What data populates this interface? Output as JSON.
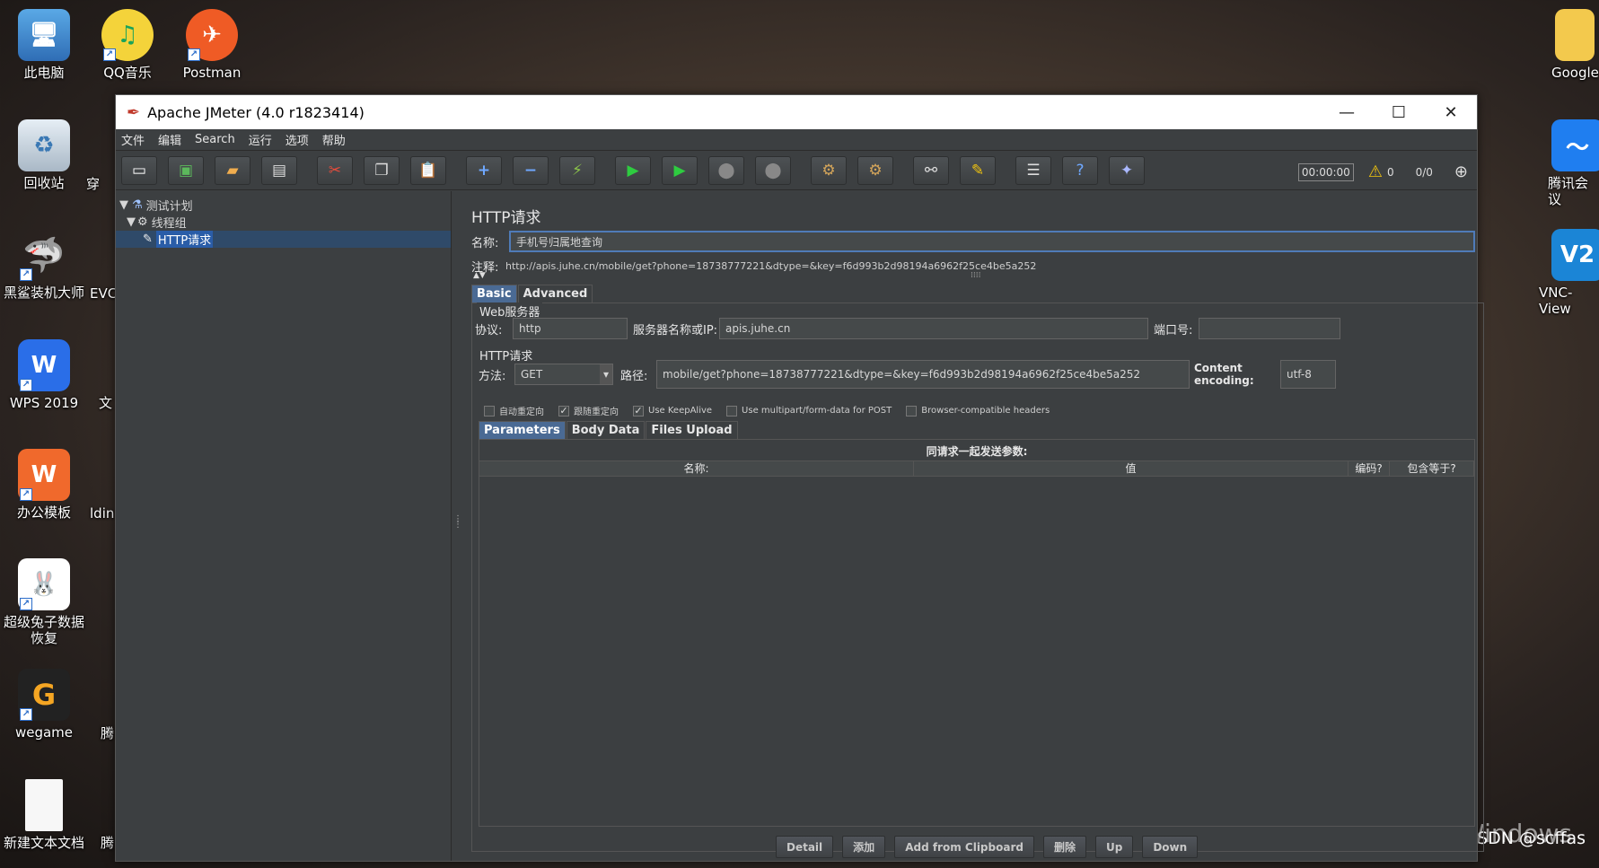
{
  "desktop": {
    "icons": [
      {
        "label": "此电脑",
        "icon": "computer-icon"
      },
      {
        "label": "QQ音乐",
        "icon": "qq-music-icon"
      },
      {
        "label": "Postman",
        "icon": "postman-icon"
      },
      {
        "label": "回收站",
        "icon": "recycle-bin-icon"
      },
      {
        "label": "黑鲨装机大师",
        "icon": "black-shark-icon"
      },
      {
        "label": "WPS 2019",
        "icon": "wps-icon"
      },
      {
        "label": "办公模板",
        "icon": "office-template-icon"
      },
      {
        "label": "超级兔子数据恢复",
        "icon": "rabbit-icon"
      },
      {
        "label": "wegame",
        "icon": "wegame-icon"
      },
      {
        "label": "新建文本文档",
        "icon": "text-file-icon"
      },
      {
        "label": "Google",
        "icon": "folder-icon"
      },
      {
        "label": "腾讯会议",
        "icon": "tencent-meeting-icon"
      },
      {
        "label": "VNC-View",
        "icon": "vnc-icon"
      },
      {
        "label": "EVC",
        "icon": "evc-icon"
      },
      {
        "label": "文",
        "icon": "doc-icon"
      },
      {
        "label": "ldin",
        "icon": "ldin-icon"
      },
      {
        "label": "腾",
        "icon": "tencent-icon"
      },
      {
        "label": "腾",
        "icon": "tencent-icon"
      },
      {
        "label": "穿",
        "icon": "app-icon"
      }
    ],
    "watermark": "激活 Windows",
    "csdn": "CSDN @scffas"
  },
  "window": {
    "title": "Apache JMeter (4.0 r1823414)",
    "controls": {
      "minimize": "—",
      "maximize": "☐",
      "close": "✕"
    }
  },
  "menu": [
    "文件",
    "编辑",
    "Search",
    "运行",
    "选项",
    "帮助"
  ],
  "toolbar": {
    "timer": "00:00:00",
    "warnings": "0",
    "threads": "0/0"
  },
  "tree": {
    "items": [
      {
        "label": "测试计划",
        "icon": "flask-icon"
      },
      {
        "label": "线程组",
        "icon": "gear-icon"
      },
      {
        "label": "HTTP请求",
        "icon": "pencil-icon"
      }
    ]
  },
  "panel": {
    "title": "HTTP请求",
    "name_label": "名称:",
    "name_value": "手机号归属地查询",
    "comment_label": "注释:",
    "comment_value": "http://apis.juhe.cn/mobile/get?phone=18738777221&dtype=&key=f6d993b2d98194a6962f25ce4be5a252",
    "tabs": [
      "Basic",
      "Advanced"
    ],
    "web_server": {
      "group": "Web服务器",
      "protocol_label": "协议:",
      "protocol_value": "http",
      "server_label": "服务器名称或IP:",
      "server_value": "apis.juhe.cn",
      "port_label": "端口号:",
      "port_value": ""
    },
    "http_request": {
      "group": "HTTP请求",
      "method_label": "方法:",
      "method_value": "GET",
      "path_label": "路径:",
      "path_value": "mobile/get?phone=18738777221&dtype=&key=f6d993b2d98194a6962f25ce4be5a252",
      "encoding_label": "Content encoding:",
      "encoding_value": "utf-8"
    },
    "checkboxes": [
      {
        "label": "自动重定向",
        "checked": false
      },
      {
        "label": "跟随重定向",
        "checked": true
      },
      {
        "label": "Use KeepAlive",
        "checked": true
      },
      {
        "label": "Use multipart/form-data for POST",
        "checked": false
      },
      {
        "label": "Browser-compatible headers",
        "checked": false
      }
    ],
    "param_tabs": [
      "Parameters",
      "Body Data",
      "Files Upload"
    ],
    "params_caption": "同请求一起发送参数:",
    "columns": [
      "名称:",
      "值",
      "编码?",
      "包含等于?"
    ],
    "buttons": [
      "Detail",
      "添加",
      "Add from Clipboard",
      "删除",
      "Up",
      "Down"
    ]
  }
}
